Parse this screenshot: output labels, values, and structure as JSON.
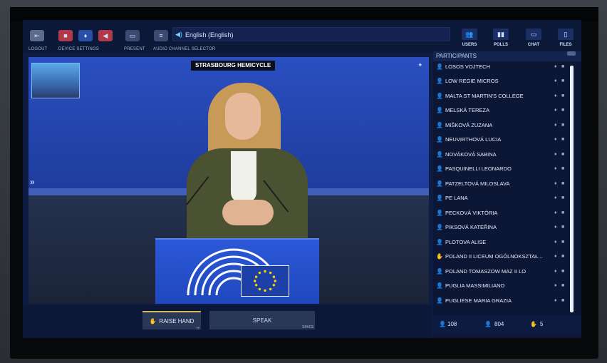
{
  "toolbar": {
    "logout_label": "LOGOUT",
    "device_settings_label": "DEVICE SETTINGS",
    "present_label": "PRESENT",
    "audio_selector_label": "AUDIO CHANNEL SELECTOR",
    "audio_channel": "English (English)",
    "users_label": "USERS",
    "polls_label": "POLLS",
    "chat_label": "CHAT",
    "files_label": "FILES"
  },
  "video": {
    "location": "STRASBOURG HEMICYCLE"
  },
  "controls": {
    "raise_hand_label": "RAISE HAND",
    "raise_hand_hint": "H",
    "speak_label": "SPEAK",
    "speak_hint": "SPACE"
  },
  "participants": {
    "title": "PARTICIPANTS",
    "items": [
      {
        "name": "LOSOS VOJTECH",
        "icon": "user-icon"
      },
      {
        "name": "LOW REGIE MICROS",
        "icon": "user-icon"
      },
      {
        "name": "MALTA ST MARTIN'S COLLEGE",
        "icon": "user-icon"
      },
      {
        "name": "MELSKÁ TEREZA",
        "icon": "user-icon"
      },
      {
        "name": "MIŠKOVÁ ZUZANA",
        "icon": "user-icon"
      },
      {
        "name": "NEUVIRTHOVÁ LUCIA",
        "icon": "user-icon"
      },
      {
        "name": "NOVÁKOVÁ SABINA",
        "icon": "user-icon"
      },
      {
        "name": "PASQUINELLI LEONARDO",
        "icon": "user-icon"
      },
      {
        "name": "PATZELTOVÁ MILOSLAVA",
        "icon": "user-icon"
      },
      {
        "name": "PE LANA",
        "icon": "user-icon"
      },
      {
        "name": "PECKOVÁ VIKTÓRIA",
        "icon": "user-icon"
      },
      {
        "name": "PIKSOVÁ KATEŘINA",
        "icon": "user-icon"
      },
      {
        "name": "PLOTOVA ALISE",
        "icon": "user-icon"
      },
      {
        "name": "POLAND II LICEUM OGÓLNOKSZTAŁ...",
        "icon": "raised-hand-icon"
      },
      {
        "name": "POLAND TOMASZOW MAZ II LO",
        "icon": "user-icon"
      },
      {
        "name": "PUGLIA MASSIMILIANO",
        "icon": "user-icon"
      },
      {
        "name": "PUGLIESE MARIA GRAZIA",
        "icon": "user-icon"
      }
    ],
    "count_users": "108",
    "count_total": "804",
    "count_hands": "5"
  },
  "colors": {
    "toolbar_bg": "#0b1838",
    "panel_bg": "#0c1736",
    "accent_audio": "#6fd2ff",
    "raise_hand_accent": "#d9b864"
  }
}
